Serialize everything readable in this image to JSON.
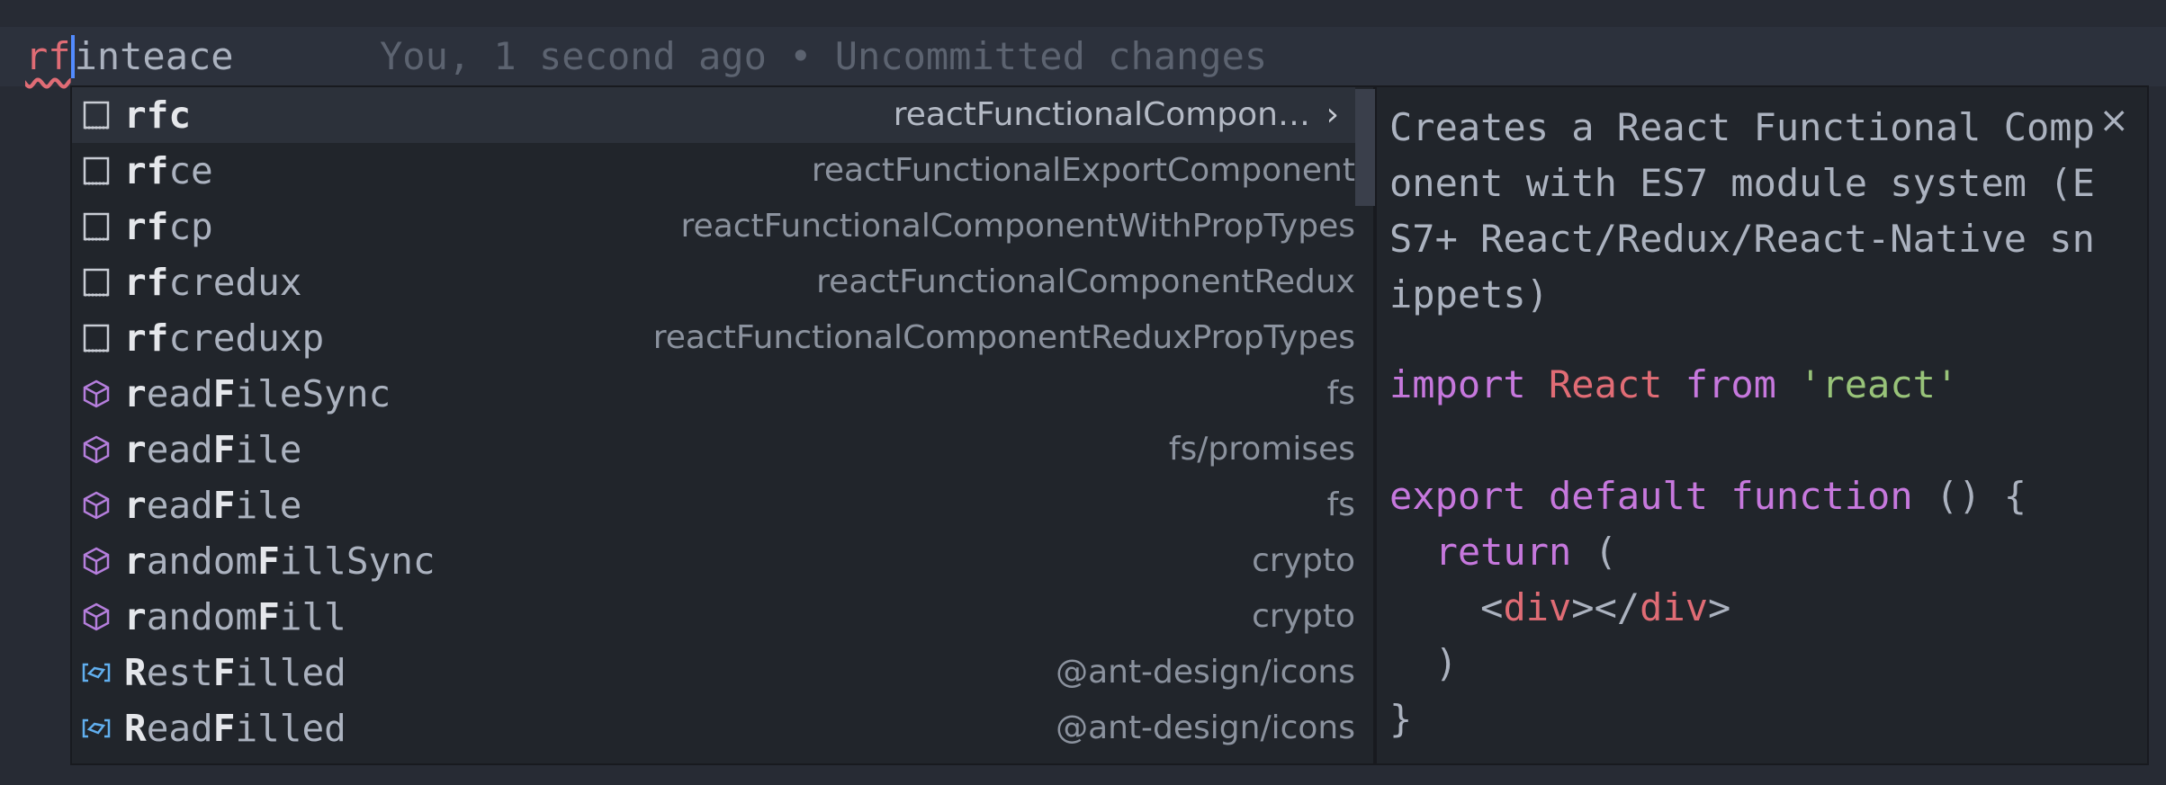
{
  "editor": {
    "typed": "rf",
    "rest": "inteace",
    "blame": "You, 1 second ago • Uncommitted changes"
  },
  "suggestions": [
    {
      "match": "rfc",
      "after": "",
      "detail": "reactFunctionalCompon…",
      "icon": "snippet-icon",
      "selected": true
    },
    {
      "match": "rf",
      "after": "ce",
      "detail": "reactFunctionalExportComponent",
      "icon": "snippet-icon"
    },
    {
      "match": "rf",
      "after": "cp",
      "detail": "reactFunctionalComponentWithPropTypes",
      "icon": "snippet-icon"
    },
    {
      "match": "rf",
      "after": "credux",
      "detail": "reactFunctionalComponentRedux",
      "icon": "snippet-icon"
    },
    {
      "match": "rf",
      "after": "creduxp",
      "detail": "reactFunctionalComponentReduxPropTypes",
      "icon": "snippet-icon"
    },
    {
      "parts": [
        [
          "r",
          true
        ],
        [
          "ead",
          false
        ],
        [
          "F",
          true
        ],
        [
          "ileSync",
          false
        ]
      ],
      "detail": "fs",
      "icon": "method-icon"
    },
    {
      "parts": [
        [
          "r",
          true
        ],
        [
          "ead",
          false
        ],
        [
          "F",
          true
        ],
        [
          "ile",
          false
        ]
      ],
      "detail": "fs/promises",
      "icon": "method-icon"
    },
    {
      "parts": [
        [
          "r",
          true
        ],
        [
          "ead",
          false
        ],
        [
          "F",
          true
        ],
        [
          "ile",
          false
        ]
      ],
      "detail": "fs",
      "icon": "method-icon"
    },
    {
      "parts": [
        [
          "r",
          true
        ],
        [
          "andom",
          false
        ],
        [
          "F",
          true
        ],
        [
          "illSync",
          false
        ]
      ],
      "detail": "crypto",
      "icon": "method-icon"
    },
    {
      "parts": [
        [
          "r",
          true
        ],
        [
          "andom",
          false
        ],
        [
          "F",
          true
        ],
        [
          "ill",
          false
        ]
      ],
      "detail": "crypto",
      "icon": "method-icon"
    },
    {
      "parts": [
        [
          "R",
          true
        ],
        [
          "est",
          false
        ],
        [
          "F",
          true
        ],
        [
          "illed",
          false
        ]
      ],
      "detail": "@ant-design/icons",
      "icon": "variable-icon"
    },
    {
      "parts": [
        [
          "R",
          true
        ],
        [
          "ead",
          false
        ],
        [
          "F",
          true
        ],
        [
          "illed",
          false
        ]
      ],
      "detail": "@ant-design/icons",
      "icon": "variable-icon"
    }
  ],
  "chevron": "›",
  "doc": {
    "description": "Creates a React Functional Component with ES7 module system (ES7+ React/Redux/React-Native snippets)",
    "close": "×",
    "code": [
      [
        [
          "import",
          "kw"
        ],
        [
          " ",
          "pun"
        ],
        [
          "React",
          "id"
        ],
        [
          " ",
          "pun"
        ],
        [
          "from",
          "kw"
        ],
        [
          " ",
          "pun"
        ],
        [
          "'react'",
          "str"
        ]
      ],
      [],
      [
        [
          "export",
          "kw"
        ],
        [
          " ",
          "pun"
        ],
        [
          "default",
          "kw"
        ],
        [
          " ",
          "pun"
        ],
        [
          "function",
          "kw"
        ],
        [
          " () {",
          "pun"
        ]
      ],
      [
        [
          "  ",
          "pun"
        ],
        [
          "return",
          "kw"
        ],
        [
          " (",
          "pun"
        ]
      ],
      [
        [
          "    <",
          "pun"
        ],
        [
          "div",
          "tag"
        ],
        [
          "></",
          "pun"
        ],
        [
          "div",
          "tag"
        ],
        [
          ">",
          "pun"
        ]
      ],
      [
        [
          "  )",
          "pun"
        ]
      ],
      [
        [
          "}",
          "pun"
        ]
      ]
    ]
  },
  "colors": {
    "snippet": "#c8ccd4",
    "method": "#b57edc",
    "variable": "#61afef"
  }
}
